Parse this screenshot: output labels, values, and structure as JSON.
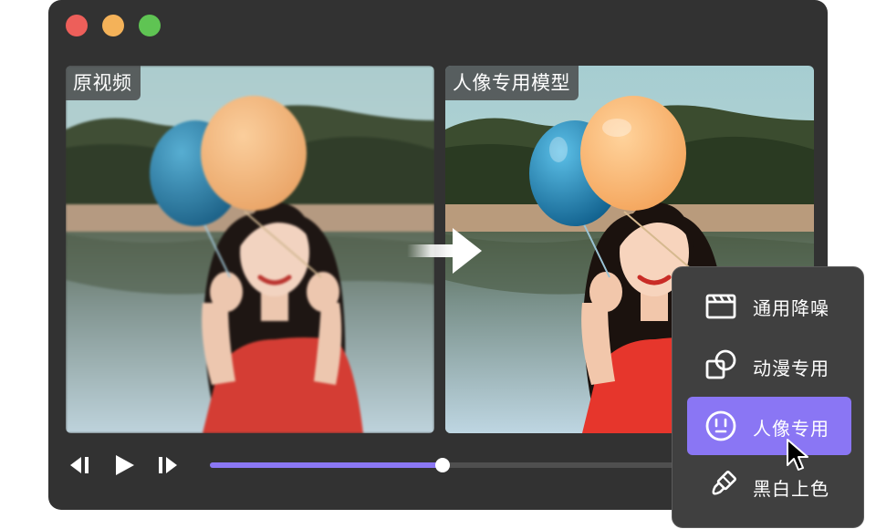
{
  "window": {
    "traffic_lights": [
      {
        "name": "close",
        "color": "#ed5f5a"
      },
      {
        "name": "minimize",
        "color": "#f4b259"
      },
      {
        "name": "maximize",
        "color": "#5fc453"
      }
    ]
  },
  "panels": {
    "original_label": "原视频",
    "enhanced_label": "人像专用模型"
  },
  "playback": {
    "prev_icon": "skip-previous-icon",
    "play_icon": "play-icon",
    "next_icon": "skip-next-icon",
    "progress": 0.49,
    "accent": "#8b77f4"
  },
  "model_menu": {
    "items": [
      {
        "label": "通用降噪",
        "icon": "clapperboard-icon",
        "selected": false
      },
      {
        "label": "动漫专用",
        "icon": "overlapping-shapes-icon",
        "selected": false
      },
      {
        "label": "人像专用",
        "icon": "face-icon",
        "selected": true
      },
      {
        "label": "黑白上色",
        "icon": "paint-brush-icon",
        "selected": false
      }
    ],
    "selected_color": "#8a76f4"
  }
}
